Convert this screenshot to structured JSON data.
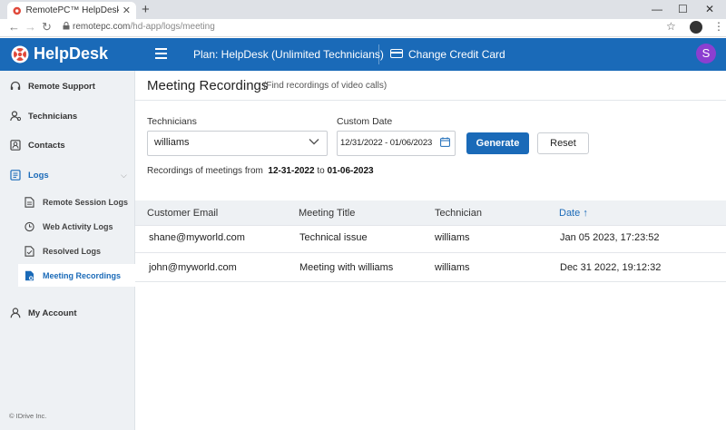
{
  "browser": {
    "tab_title": "RemotePC™ HelpDesk - Web Act",
    "url_host": "remotepc.com",
    "url_path": "/hd-app/logs/meeting"
  },
  "header": {
    "logo_text": "HelpDesk",
    "plan_text": "Plan: HelpDesk (Unlimited Technicians)",
    "change_card_text": "Change Credit Card",
    "avatar_letter": "S"
  },
  "sidebar": {
    "items": [
      {
        "label": "Remote Support",
        "icon": "headset-icon"
      },
      {
        "label": "Technicians",
        "icon": "technicians-icon"
      },
      {
        "label": "Contacts",
        "icon": "contacts-icon"
      },
      {
        "label": "Logs",
        "icon": "logs-icon"
      }
    ],
    "sub_items": [
      {
        "label": "Remote Session Logs",
        "icon": "document-icon"
      },
      {
        "label": "Web Activity Logs",
        "icon": "clock-icon"
      },
      {
        "label": "Resolved Logs",
        "icon": "document-check-icon"
      },
      {
        "label": "Meeting Recordings",
        "icon": "recording-icon"
      }
    ],
    "account_label": "My Account",
    "copyright": "© IDrive Inc."
  },
  "main": {
    "title": "Meeting Recordings",
    "subtitle": "(Find recordings of video calls)",
    "technicians_label": "Technicians",
    "technician_value": "williams",
    "custom_date_label": "Custom Date",
    "date_range_value": "12/31/2022 - 01/06/2023",
    "generate_label": "Generate",
    "reset_label": "Reset",
    "range_prefix": "Recordings of meetings from",
    "range_from": "12-31-2022",
    "range_to_word": "to",
    "range_to": "01-06-2023"
  },
  "table": {
    "columns": [
      "Customer Email",
      "Meeting Title",
      "Technician",
      "Date"
    ],
    "sort_indicator": "↑",
    "rows": [
      [
        "shane@myworld.com",
        "Technical issue",
        "williams",
        "Jan 05 2023, 17:23:52"
      ],
      [
        "john@myworld.com",
        "Meeting with williams",
        "williams",
        "Dec 31 2022, 19:12:32"
      ]
    ]
  },
  "colors": {
    "brand_blue": "#1a6ab8",
    "avatar_purple": "#8b3fd0",
    "sidebar_bg": "#eef1f4"
  }
}
